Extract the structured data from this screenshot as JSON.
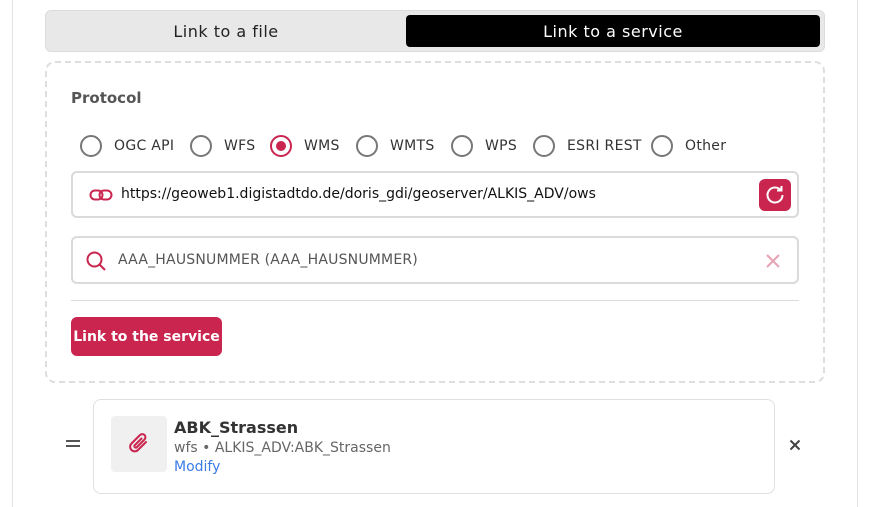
{
  "tabs": {
    "file_label": "Link to a file",
    "service_label": "Link to a service"
  },
  "form": {
    "protocol_label": "Protocol",
    "protocols": [
      {
        "label": "OGC API",
        "checked": false
      },
      {
        "label": "WFS",
        "checked": false
      },
      {
        "label": "WMS",
        "checked": true
      },
      {
        "label": "WMTS",
        "checked": false
      },
      {
        "label": "WPS",
        "checked": false
      },
      {
        "label": "ESRI REST",
        "checked": false
      },
      {
        "label": "Other",
        "checked": false
      }
    ],
    "url_value": "https://geoweb1.digistadtdo.de/doris_gdi/geoserver/ALKIS_ADV/ows",
    "layer_value": "AAA_HAUSNUMMER (AAA_HAUSNUMMER)",
    "submit_label": "Link to the service"
  },
  "linked_item": {
    "title": "ABK_Strassen",
    "subtitle": "wfs • ALKIS_ADV:ABK_Strassen",
    "modify_label": "Modify"
  },
  "colors": {
    "accent": "#c9254f",
    "link": "#3b7ce8",
    "active_tab": "#000000"
  },
  "icons": [
    "link-icon",
    "refresh-icon",
    "search-icon",
    "clear-icon",
    "drag-handle-icon",
    "paperclip-icon",
    "close-icon"
  ]
}
